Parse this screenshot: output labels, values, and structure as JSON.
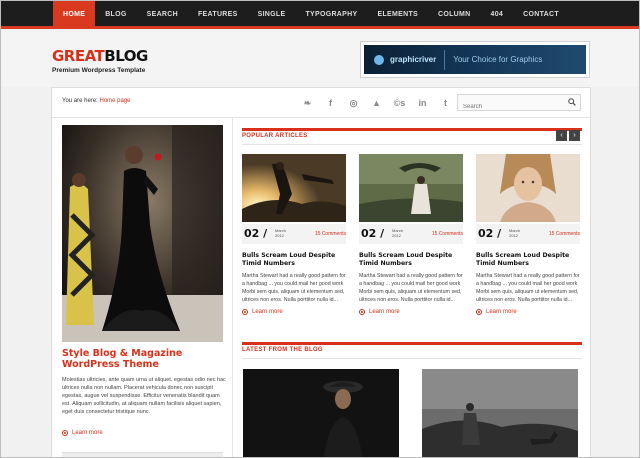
{
  "nav": {
    "items": [
      "HOME",
      "BLOG",
      "SEARCH",
      "FEATURES",
      "SINGLE",
      "TYPOGRAPHY",
      "ELEMENTS",
      "COLUMN",
      "404",
      "CONTACT"
    ]
  },
  "header": {
    "logo_red": "GREAT",
    "logo_black": "BLOG",
    "tagline": "Premium Wordpress Template",
    "banner_brand": "graphicriver",
    "banner_slogan": "Your Choice for Graphics"
  },
  "breadcrumb": {
    "prefix": "You are here:",
    "link": "Home page"
  },
  "social": {
    "icons": [
      "twitter-icon",
      "facebook-icon",
      "dribbble-icon",
      "deviantart-icon",
      "lastfm-icon",
      "linkedin-icon",
      "tumblr-icon"
    ],
    "glyphs": [
      "❧",
      "f",
      "◎",
      "▲",
      "©s",
      "in",
      "t"
    ]
  },
  "search": {
    "placeholder": "Search"
  },
  "feature": {
    "title": "Style Blog & Magazine WordPress Theme",
    "text": "Molestias ultricies, ante quam urna ut aliquet, egestas odio nec hac ultrices nulla non nullam. Placerat vehicula donec non suscipit egestas, augue vel suspendisse. Efficitur venenatis blandit quam est. Aliquam sollicitudin, at aliquam nullam facilisis aliquet sapien, eget duis consectetur tristique nunc.",
    "readmore": "Learn more"
  },
  "popular": {
    "heading": "POPULAR ARTICLES",
    "prev": "‹",
    "next": "›",
    "cards": [
      {
        "day": "02 /",
        "month": "March",
        "year": "2012",
        "comments": "15 Comments",
        "title": "Bulls Scream Loud Despite Timid Numbers",
        "text": "Martha Stewart had a really good pattern for a handbag ... you could mail her good work Morbi sem quis, aliquam ut elementum sed, ultrices non eros. Nulla porttitor nulla id...",
        "readmore": "Learn more"
      },
      {
        "day": "02 /",
        "month": "March",
        "year": "2012",
        "comments": "15 Comments",
        "title": "Bulls Scream Loud Despite Timid Numbers",
        "text": "Martha Stewart had a really good pattern for a handbag ... you could mail her good work Morbi sem quis, aliquam ut elementum sed, ultrices non eros. Nulla porttitor nulla id...",
        "readmore": "Learn more"
      },
      {
        "day": "02 /",
        "month": "March",
        "year": "2012",
        "comments": "15 Comments",
        "title": "Bulls Scream Loud Despite Timid Numbers",
        "text": "Martha Stewart had a really good pattern for a handbag ... you could mail her good work Morbi sem quis, aliquam ut elementum sed, ultrices non eros. Nulla porttitor nulla id...",
        "readmore": "Learn more"
      }
    ]
  },
  "latest": {
    "heading": "LATEST FROM THE BLOG"
  },
  "colors": {
    "accent": "#d9301a",
    "nav_bg": "#1d1d1d"
  }
}
